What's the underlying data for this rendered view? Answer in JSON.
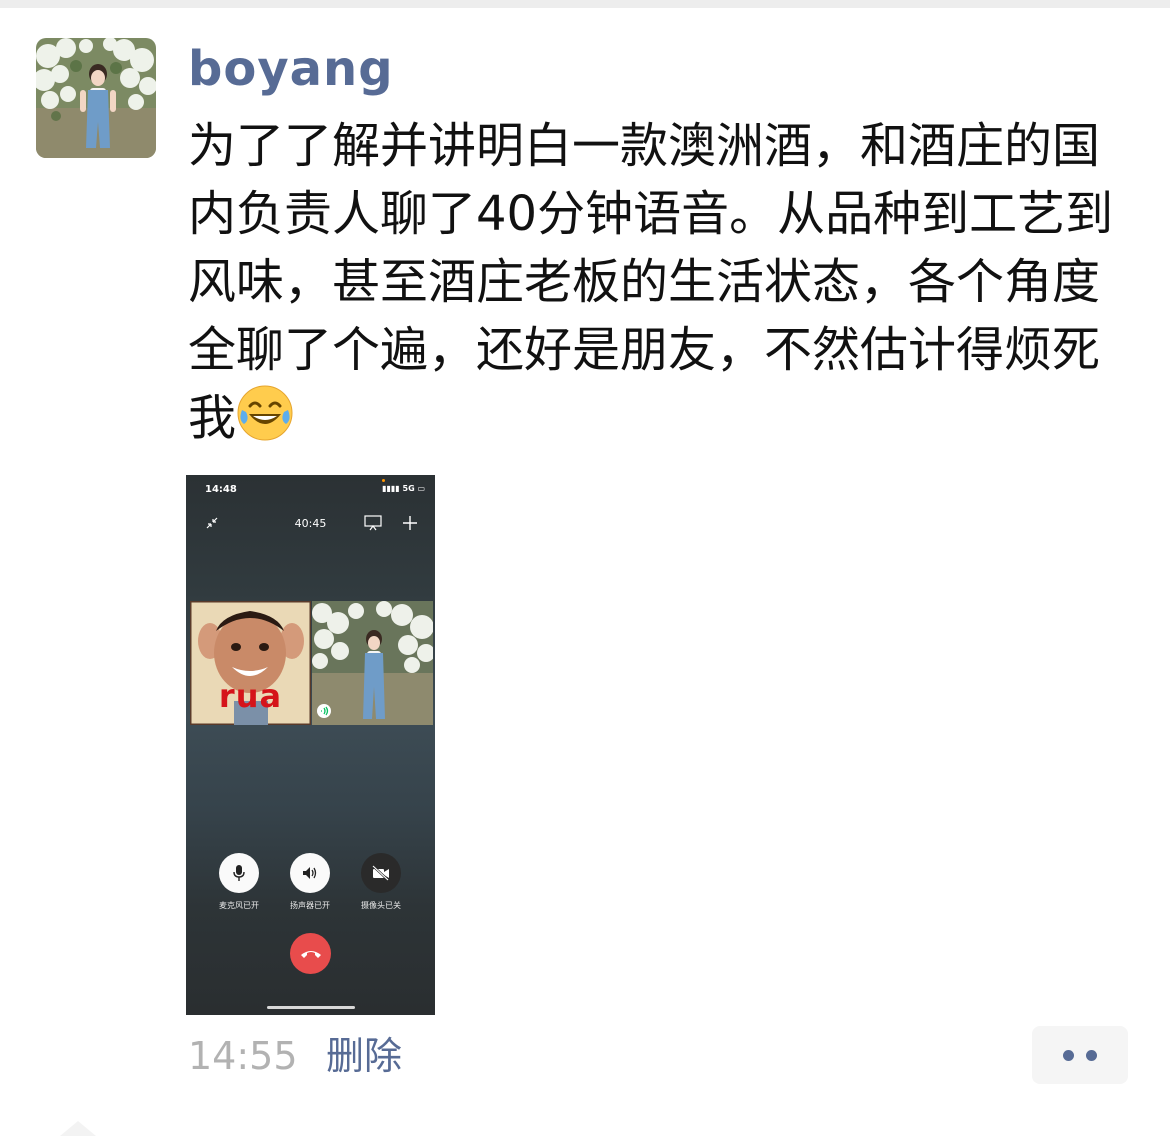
{
  "post": {
    "username": "boyang",
    "text": "为了了解并讲明白一款澳洲酒，和酒庄的国内负责人聊了40分钟语音。从品种到工艺到风味，甚至酒庄老板的生活状态，各个角度全聊了个遍，还好是朋友，不然估计得烦死我",
    "emoji": "laughing-with-tears-emoji",
    "timestamp": "14:55",
    "delete_label": "删除"
  },
  "screenshot": {
    "status_time": "14:48",
    "status_network": "5G",
    "call_duration": "40:45",
    "sticker_text": "rua",
    "controls": [
      {
        "label": "麦克风已开",
        "icon": "microphone-icon",
        "active": true
      },
      {
        "label": "扬声器已开",
        "icon": "speaker-icon",
        "active": true
      },
      {
        "label": "摄像头已关",
        "icon": "camera-off-icon",
        "active": false
      }
    ],
    "hangup_icon": "hangup-icon"
  },
  "colors": {
    "link": "#576b95",
    "timestamp": "#b2b2b2",
    "hangup": "#e84c4c",
    "text": "#111111"
  }
}
